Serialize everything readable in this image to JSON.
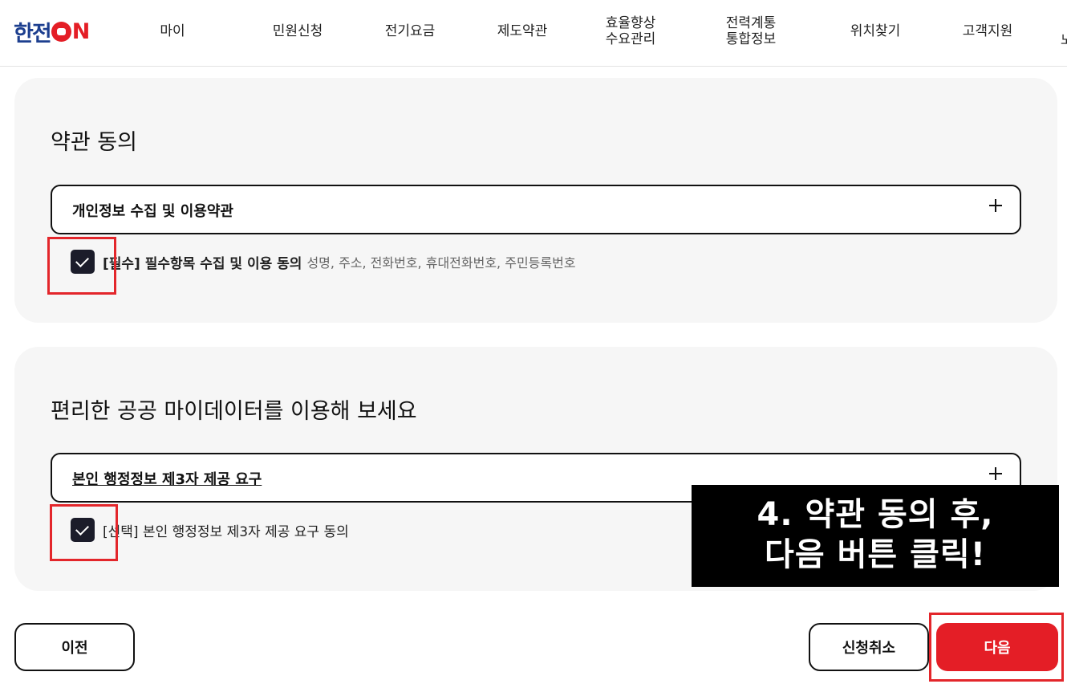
{
  "header": {
    "logo": {
      "prefix": "한전",
      "o": "O",
      "n": "N"
    },
    "nav": [
      {
        "line1": "마이",
        "line2": ""
      },
      {
        "line1": "민원신청",
        "line2": ""
      },
      {
        "line1": "전기요금",
        "line2": ""
      },
      {
        "line1": "제도약관",
        "line2": ""
      },
      {
        "line1": "효율향상",
        "line2": "수요관리"
      },
      {
        "line1": "전력계통",
        "line2": "통합정보"
      },
      {
        "line1": "위치찾기",
        "line2": ""
      },
      {
        "line1": "고객지원",
        "line2": ""
      }
    ],
    "nav_edge": "노"
  },
  "terms_card": {
    "title": "약관 동의",
    "accordion_label": "개인정보 수집 및 이용약관",
    "checkbox": {
      "checked": true,
      "label": "[필수] 필수항목 수집 및 이용 동의",
      "description": "성명, 주소, 전화번호, 휴대전화번호, 주민등록번호"
    }
  },
  "mydata_card": {
    "title": "편리한 공공 마이데이터를 이용해 보세요",
    "accordion_label": "본인 행정정보 제3자 제공 요구",
    "checkbox": {
      "checked": true,
      "label": "[선택] 본인 행정정보 제3자 제공 요구 동의"
    }
  },
  "overlay": {
    "line1": "4. 약관 동의 후,",
    "line2": "다음 버튼 클릭!"
  },
  "buttons": {
    "prev": "이전",
    "cancel": "신청취소",
    "next": "다음"
  },
  "colors": {
    "brand_blue": "#1d3f8f",
    "brand_red": "#e41e26",
    "annotation_red": "#e3262b",
    "card_bg": "#f6f6f6",
    "checkbox_dark": "#1b1c2a"
  }
}
